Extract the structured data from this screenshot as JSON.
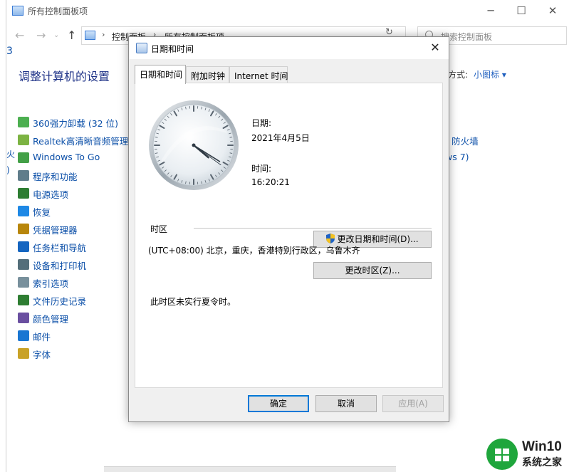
{
  "control_panel": {
    "title": "所有控制面板项",
    "breadcrumb": [
      "控制面板",
      "所有控制面板项"
    ],
    "search_placeholder": "搜索控制面板",
    "heading": "调整计算机的设置",
    "view_by_label": "方式:",
    "view_by_value": "小图标 ▾",
    "items": [
      {
        "label": "360强力卸载 (32 位)",
        "icon": "uninstall-icon",
        "color": "#4caf50"
      },
      {
        "label": "Realtek高清晰音频管理器",
        "icon": "audio-icon",
        "color": "#7cb342"
      },
      {
        "label": "Windows To Go",
        "icon": "windows-to-go-icon",
        "color": "#43a047"
      },
      {
        "label": "程序和功能",
        "icon": "programs-icon",
        "color": "#607d8b"
      },
      {
        "label": "电源选项",
        "icon": "power-icon",
        "color": "#2e7d32"
      },
      {
        "label": "恢复",
        "icon": "recovery-icon",
        "color": "#1e88e5"
      },
      {
        "label": "凭据管理器",
        "icon": "credential-icon",
        "color": "#b8860b"
      },
      {
        "label": "任务栏和导航",
        "icon": "taskbar-icon",
        "color": "#1565c0"
      },
      {
        "label": "设备和打印机",
        "icon": "printer-icon",
        "color": "#546e7a"
      },
      {
        "label": "索引选项",
        "icon": "index-icon",
        "color": "#78909c"
      },
      {
        "label": "文件历史记录",
        "icon": "file-history-icon",
        "color": "#2e7d32"
      },
      {
        "label": "颜色管理",
        "icon": "color-management-icon",
        "color": "#6a4fa0"
      },
      {
        "label": "邮件",
        "icon": "mail-icon",
        "color": "#1976d2"
      },
      {
        "label": "字体",
        "icon": "font-icon",
        "color": "#c9a227"
      }
    ],
    "right_fragments": [
      "r 防火墙",
      "ws 7)"
    ]
  },
  "dialog": {
    "title": "日期和时间",
    "tabs": [
      "日期和时间",
      "附加时钟",
      "Internet 时间"
    ],
    "active_tab": 0,
    "date_label": "日期:",
    "date_value": "2021年4月5日",
    "time_label": "时间:",
    "time_value": "16:20:21",
    "change_datetime_button": "更改日期和时间(D)...",
    "timezone_group_label": "时区",
    "timezone_value": "(UTC+08:00) 北京，重庆，香港特别行政区，乌鲁木齐",
    "change_timezone_button": "更改时区(Z)...",
    "dst_note": "此时区未实行夏令时。",
    "ok_button": "确定",
    "cancel_button": "取消",
    "apply_button": "应用(A)"
  },
  "watermark": {
    "text1": "Win10",
    "text2": "系统之家"
  },
  "colors": {
    "link": "#0b4fa8",
    "heading": "#1e3287",
    "focus": "#0078d7"
  }
}
